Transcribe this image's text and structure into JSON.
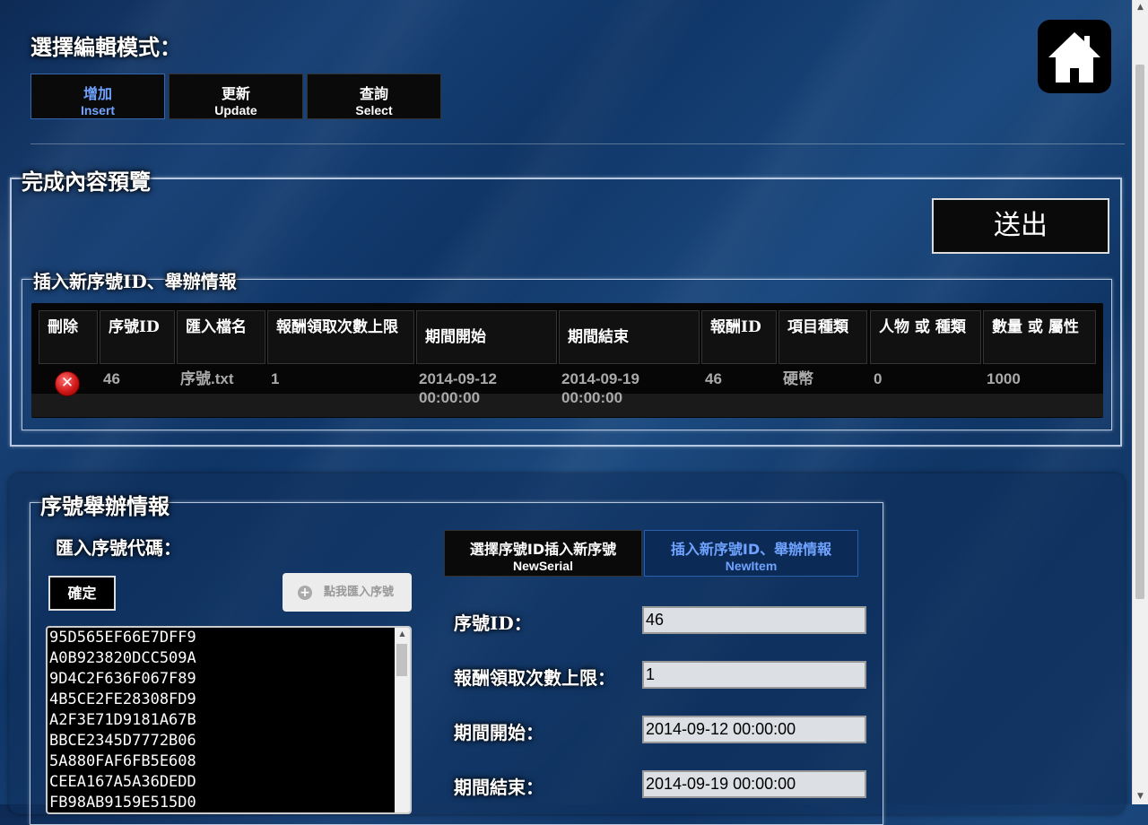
{
  "mode": {
    "title": "選擇編輯模式：",
    "buttons": [
      {
        "zh": "增加",
        "en": "Insert"
      },
      {
        "zh": "更新",
        "en": "Update"
      },
      {
        "zh": "查詢",
        "en": "Select"
      }
    ],
    "active": "Insert"
  },
  "home_icon": "home-icon",
  "preview": {
    "legend": "完成內容預覽",
    "send_label": "送出",
    "sub_legend": "插入新序號ID、舉辦情報",
    "headers": [
      "刪除",
      "序號ID",
      "匯入檔名",
      "報酬領取次數上限",
      "期間開始",
      "期間結束",
      "報酬ID",
      "項目種類",
      "人物 或 種類",
      "數量 或 屬性"
    ],
    "row": {
      "serial_id": "46",
      "filename": "序號.txt",
      "limit": "1",
      "start": "2014-09-12 00:00:00",
      "end": "2014-09-19 00:00:00",
      "reward_id": "46",
      "item_type": "硬幣",
      "character": "0",
      "quantity": "1000"
    }
  },
  "serial": {
    "legend": "序號舉辦情報",
    "import_label": "匯入序號代碼：",
    "confirm_label": "確定",
    "import_button": "點我匯入序號",
    "codes": [
      "95D565EF66E7DFF9",
      "A0B923820DCC509A",
      "9D4C2F636F067F89",
      "4B5CE2FE28308FD9",
      "A2F3E71D9181A67B",
      "BBCE2345D7772B06",
      "5A880FAF6FB5E608",
      "CEEA167A5A36DEDD",
      "FB98AB9159E515D0"
    ],
    "tabs": [
      {
        "zh": "選擇序號ID插入新序號",
        "en": "NewSerial"
      },
      {
        "zh": "插入新序號ID、舉辦情報",
        "en": "NewItem"
      }
    ],
    "active_tab": "NewItem",
    "fields": [
      {
        "label": "序號ID：",
        "value": "46"
      },
      {
        "label": "報酬領取次數上限：",
        "value": "1"
      },
      {
        "label": "期間開始：",
        "value": "2014-09-12 00:00:00"
      },
      {
        "label": "期間結束：",
        "value": "2014-09-19 00:00:00"
      }
    ]
  },
  "colors": {
    "active_text": "#6fa3ff",
    "panel_bg": "#0a0a0a",
    "delete_red": "#d01818"
  }
}
